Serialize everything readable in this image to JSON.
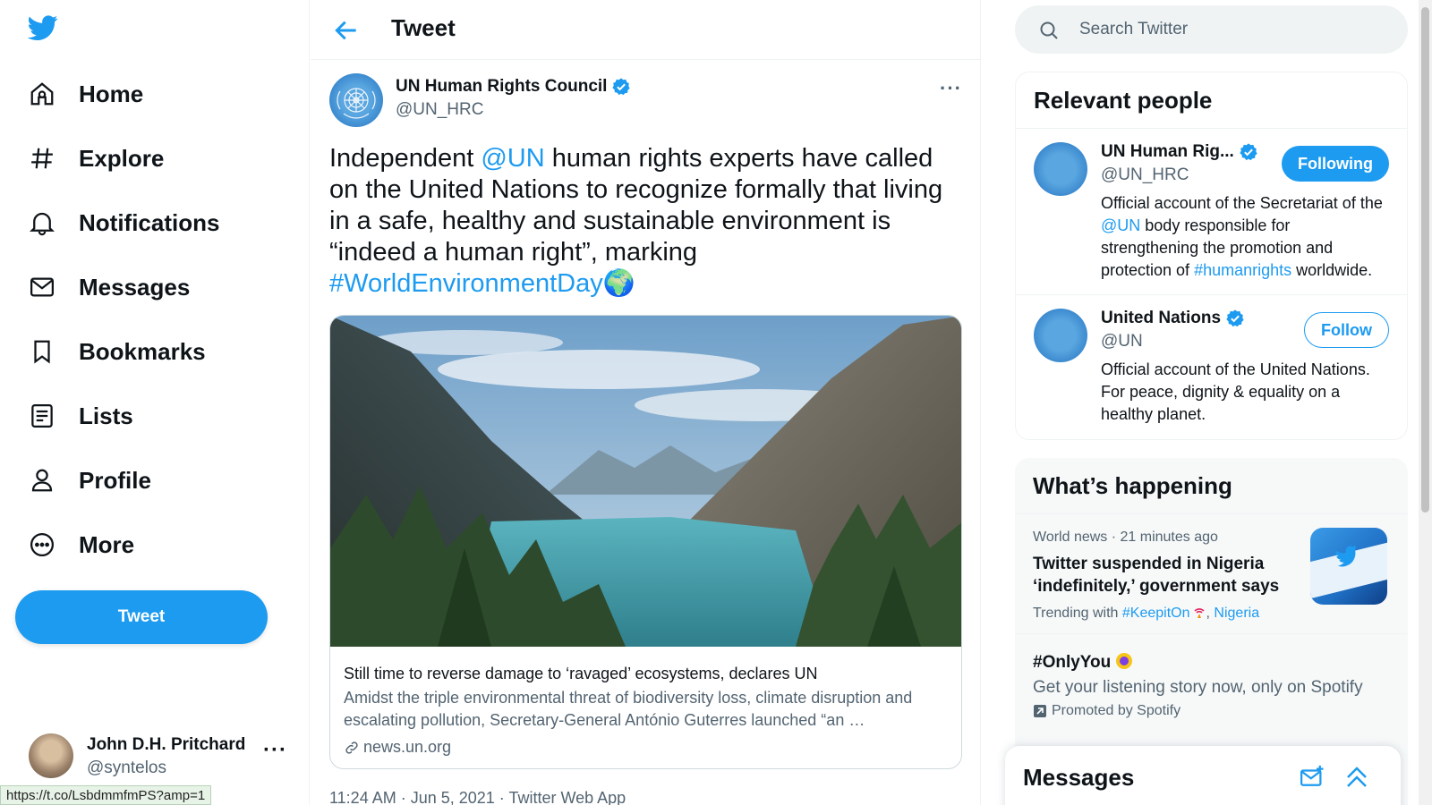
{
  "nav": {
    "items": [
      {
        "label": "Home",
        "icon": "home-icon"
      },
      {
        "label": "Explore",
        "icon": "hashtag-icon"
      },
      {
        "label": "Notifications",
        "icon": "bell-icon"
      },
      {
        "label": "Messages",
        "icon": "envelope-icon"
      },
      {
        "label": "Bookmarks",
        "icon": "bookmark-icon"
      },
      {
        "label": "Lists",
        "icon": "list-icon"
      },
      {
        "label": "Profile",
        "icon": "person-icon"
      },
      {
        "label": "More",
        "icon": "more-circle-icon"
      }
    ],
    "tweet_button": "Tweet"
  },
  "account": {
    "name": "John D.H. Pritchard",
    "handle": "@syntelos",
    "more": "···"
  },
  "status_url": "https://t.co/LsbdmmfmPS?amp=1",
  "header": {
    "title": "Tweet"
  },
  "tweet": {
    "author_name": "UN Human Rights Council",
    "author_handle": "@UN_HRC",
    "more": "···",
    "text_before": "Independent ",
    "mention": "@UN",
    "text_after": " human rights experts have called on the United Nations to recognize formally that living in a safe, healthy and sustainable environment is “indeed a human right”, marking ",
    "hashtag": "#WorldEnvironmentDay",
    "emoji": "🌍",
    "card": {
      "title": "Still time to reverse damage to ‘ravaged’ ecosystems, declares UN",
      "description": "Amidst the triple environmental threat of biodiversity loss, climate disruption and escalating pollution, Secretary-General António Guterres launched “an …",
      "domain": "news.un.org"
    },
    "meta": "11:24 AM · Jun 5, 2021 · Twitter Web App"
  },
  "search": {
    "placeholder": "Search Twitter"
  },
  "relevant": {
    "title": "Relevant people",
    "people": [
      {
        "name": "UN Human Rig...",
        "handle": "@UN_HRC",
        "button": "Following",
        "bio_before": "Official account of the Secretariat of the ",
        "bio_mention": "@UN",
        "bio_middle": " body responsible for strengthening the promotion and protection of ",
        "bio_hashtag": "#humanrights",
        "bio_after": " worldwide."
      },
      {
        "name": "United Nations",
        "handle": "@UN",
        "button": "Follow",
        "bio": "Official account of the United Nations. For peace, dignity & equality on a healthy planet."
      }
    ]
  },
  "happening": {
    "title": "What’s happening",
    "trend1": {
      "meta": "World news · 21 minutes ago",
      "title": "Twitter suspended in Nigeria ‘indefinitely,’ government says",
      "with_label": "Trending with ",
      "tag1": "#KeepitOn",
      "separator": ", ",
      "tag2": "Nigeria"
    },
    "trend2": {
      "title": "#OnlyYou",
      "subtitle": "Get your listening story now, only on Spotify",
      "promoted": "Promoted by Spotify"
    }
  },
  "messages_bar": {
    "title": "Messages"
  },
  "colors": {
    "accent": "#1d9bf0",
    "text": "#0f1419",
    "muted": "#536471"
  }
}
